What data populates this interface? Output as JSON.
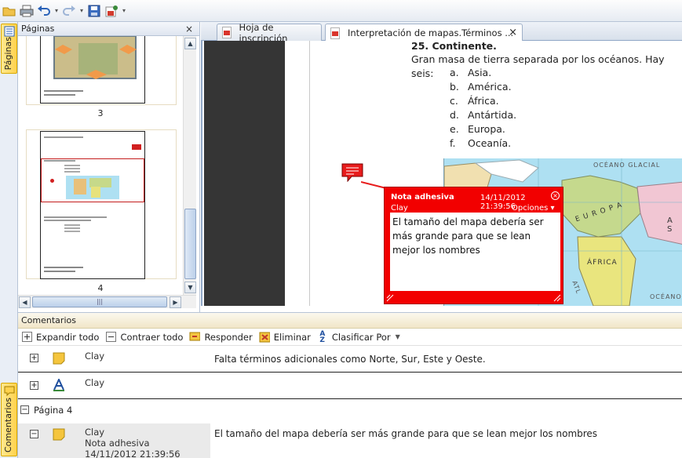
{
  "toolbar": {
    "icons": [
      "open-folder-icon",
      "print-icon",
      "undo-icon",
      "redo-icon",
      "save-icon",
      "export-icon",
      "customize-icon"
    ]
  },
  "sidebar": {
    "pages_tab_label": "Páginas",
    "comments_tab_label": "Comentarios"
  },
  "pages_panel": {
    "title": "Páginas",
    "close_label": "×",
    "page_numbers": [
      "3",
      "4"
    ]
  },
  "tabs": [
    {
      "label": "Hoja de inscripción"
    },
    {
      "label": "Interpretación de mapas.Términos ..."
    }
  ],
  "tab_close_label": "×",
  "document": {
    "heading": "25.  Continente.",
    "paragraph": "Gran masa de tierra separada por los océanos. Hay seis:",
    "list": [
      {
        "marker": "a.",
        "text": "Asia."
      },
      {
        "marker": "b.",
        "text": "América."
      },
      {
        "marker": "c.",
        "text": "África."
      },
      {
        "marker": "d.",
        "text": "Antártida."
      },
      {
        "marker": "e.",
        "text": "Europa."
      },
      {
        "marker": "f.",
        "text": "Oceanía."
      }
    ],
    "map_labels": {
      "ocean_glacial": "OCÉANO  GLACIAL",
      "europa": "E U R O P A",
      "asia": "A S",
      "africa": "ÁFRICA",
      "ocean_bottom": "OCÉANO",
      "atl": "ATL"
    }
  },
  "sticky_note": {
    "title": "Nota adhesiva",
    "datetime": "14/11/2012 21:39:56",
    "author": "Clay",
    "options_label": "Opciones",
    "close_label": "×",
    "text": "El tamaño del mapa debería ser más grande para que se lean mejor los nombres"
  },
  "comments": {
    "title": "Comentarios",
    "toolbar": {
      "expand_all": "Expandir todo",
      "collapse_all": "Contraer todo",
      "reply": "Responder",
      "delete": "Eliminar",
      "sort_by": "Clasificar Por"
    },
    "rows": [
      {
        "author": "Clay",
        "text": "Falta términos adicionales como Norte, Sur, Este y Oeste."
      },
      {
        "author": "Clay",
        "text": ""
      }
    ],
    "page_group": "Página 4",
    "group_rows": [
      {
        "author": "Clay",
        "type": "Nota adhesiva",
        "date": "14/11/2012 21:39:56",
        "text": "El tamaño del mapa debería ser más grande para que se lean mejor los nombres"
      }
    ]
  },
  "colors": {
    "note_red": "#f20000",
    "accent_blue": "#8fa6c6",
    "tab_yellow": "#ffd24d"
  }
}
